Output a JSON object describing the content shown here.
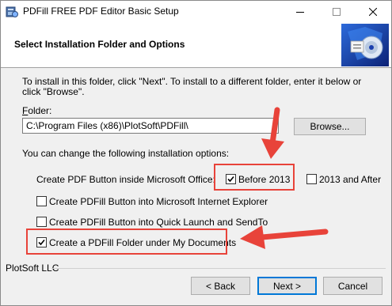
{
  "window": {
    "title": "PDFill FREE PDF Editor Basic Setup"
  },
  "header": {
    "title": "Select Installation Folder and Options"
  },
  "body": {
    "description": "To install in this folder, click \"Next\". To install to a different folder, enter it below or click \"Browse\".",
    "folder_label_accel": "F",
    "folder_label_rest": "older:",
    "folder_value": "C:\\Program Files (x86)\\PlotSoft\\PDFill\\",
    "browse_label": "Browse...",
    "options_intro": "You can change the following installation options:",
    "office_label": "Create PDF Button inside Microsoft Office:",
    "options": [
      {
        "label": "Before 2013",
        "checked": true
      },
      {
        "label": "2013 and After",
        "checked": false
      },
      {
        "label": "Create PDFill Button into Microsoft Internet Explorer",
        "checked": false
      },
      {
        "label": "Create PDFill Button into Quick Launch and SendTo",
        "checked": false
      },
      {
        "label": "Create a PDFill Folder under My Documents",
        "checked": true
      }
    ]
  },
  "footer": {
    "company": "PlotSoft LLC",
    "back_label": "< Back",
    "next_label": "Next >",
    "cancel_label": "Cancel"
  },
  "colors": {
    "highlight": "#e8433a",
    "default_button_border": "#0078d7"
  }
}
